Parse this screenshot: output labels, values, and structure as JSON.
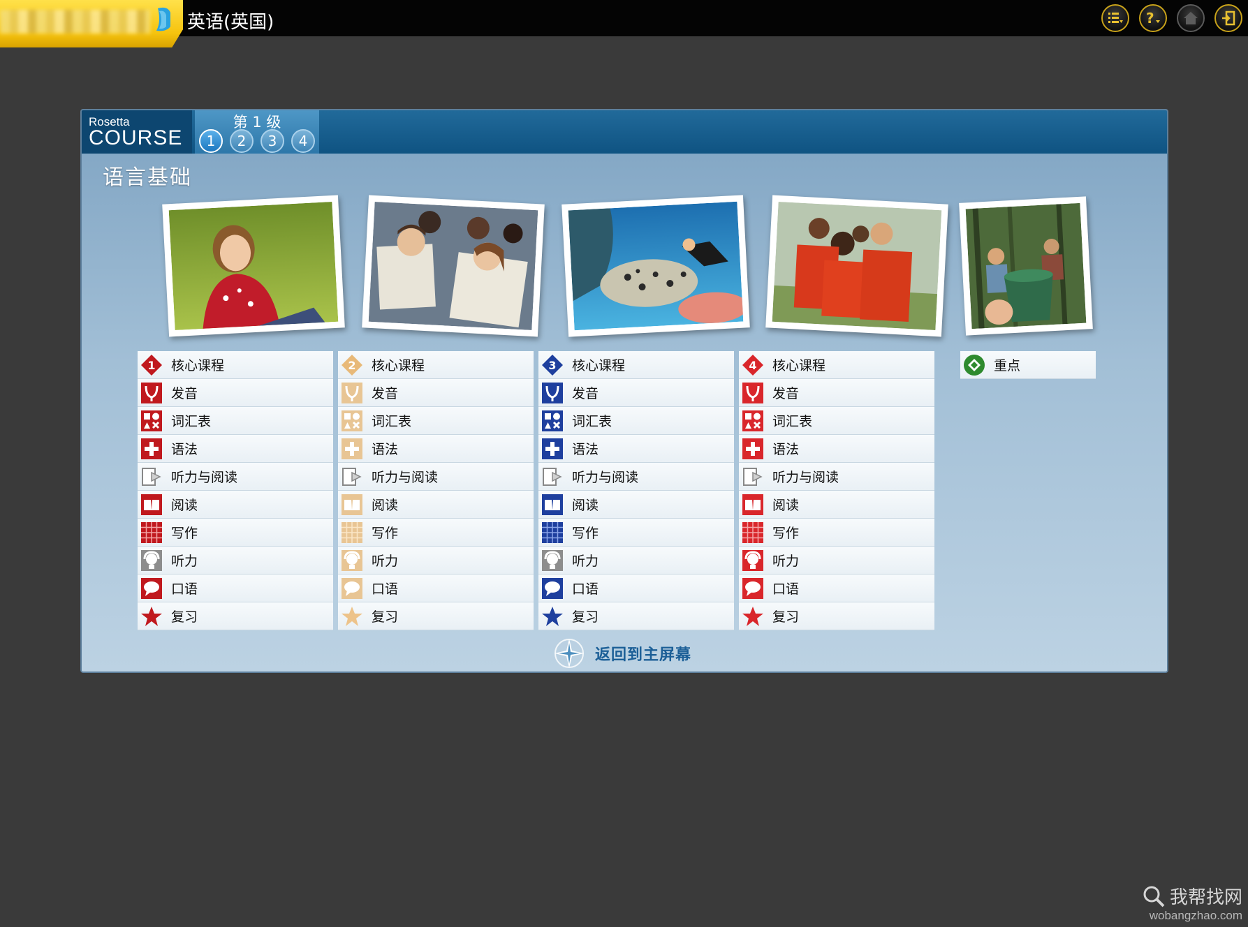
{
  "app": {
    "title": "英语(英国)"
  },
  "toolbar": {
    "icons": [
      "list-menu-icon",
      "help-icon",
      "home-icon",
      "exit-icon"
    ]
  },
  "course": {
    "logo_small": "Rosetta",
    "logo_big": "COURSE",
    "level_label": "第 1 级",
    "levels": [
      "1",
      "2",
      "3",
      "4"
    ],
    "active_level": "1",
    "section_title": "语言基础"
  },
  "units": [
    {
      "badge": "1",
      "color": "#c0191e",
      "items": [
        "核心课程",
        "发音",
        "词汇表",
        "语法",
        "听力与阅读",
        "阅读",
        "写作",
        "听力",
        "口语",
        "复习"
      ]
    },
    {
      "badge": "2",
      "color": "#e8b978",
      "items": [
        "核心课程",
        "发音",
        "词汇表",
        "语法",
        "听力与阅读",
        "阅读",
        "写作",
        "听力",
        "口语",
        "复习"
      ]
    },
    {
      "badge": "3",
      "color": "#1e3f9e",
      "items": [
        "核心课程",
        "发音",
        "词汇表",
        "语法",
        "听力与阅读",
        "阅读",
        "写作",
        "听力",
        "口语",
        "复习"
      ]
    },
    {
      "badge": "4",
      "color": "#d9262b",
      "items": [
        "核心课程",
        "发音",
        "词汇表",
        "语法",
        "听力与阅读",
        "阅读",
        "写作",
        "听力",
        "口语",
        "复习"
      ]
    }
  ],
  "focus": {
    "label": "重点",
    "color": "#2e8a2e"
  },
  "footer": {
    "back_label": "返回到主屏幕"
  },
  "watermark": {
    "line1": "我帮找网",
    "line2": "wobangzhao.com"
  },
  "colors": {
    "topbar": "#040404",
    "brand": "#f6c30e",
    "header": "#0f5382"
  }
}
